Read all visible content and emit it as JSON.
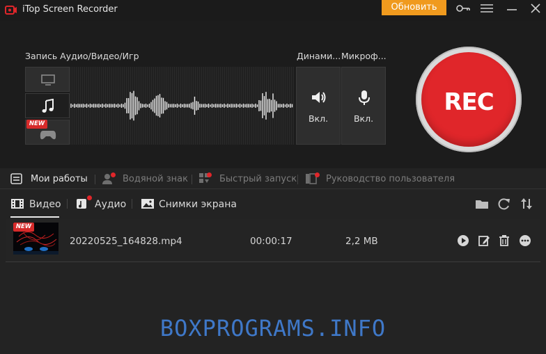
{
  "titlebar": {
    "app_title": "iTop Screen Recorder",
    "update_button": "Обновить",
    "icons": [
      "recorder-logo-icon",
      "key-icon",
      "menu-icon",
      "minimize-icon",
      "close-icon"
    ]
  },
  "record": {
    "section_label": "Запись Аудио/Видео/Игр",
    "speaker_label": "Динами...",
    "mic_label": "Микроф...",
    "speaker_state": "Вкл.",
    "mic_state": "Вкл.",
    "source_new_badge": "NEW",
    "rec_button": "REC"
  },
  "nav": {
    "items": [
      {
        "label": "Мои работы",
        "icon": "list-icon",
        "active": true
      },
      {
        "label": "Водяной знак",
        "icon": "watermark-icon",
        "active": false
      },
      {
        "label": "Быстрый запуск",
        "icon": "quick-launch-icon",
        "active": false
      },
      {
        "label": "Руководство пользователя",
        "icon": "guide-icon",
        "active": false
      }
    ]
  },
  "tabs": {
    "items": [
      {
        "label": "Видео",
        "icon": "film-icon"
      },
      {
        "label": "Аудио",
        "icon": "music-icon"
      },
      {
        "label": "Снимки экрана",
        "icon": "image-icon"
      }
    ],
    "active": "Видео",
    "tool_icons": [
      "folder-icon",
      "refresh-icon",
      "sort-icon"
    ]
  },
  "files": [
    {
      "badge": "NEW",
      "name": "20220525_164828.mp4",
      "duration": "00:00:17",
      "size": "2,2 MB",
      "actions": [
        "play-icon",
        "edit-icon",
        "delete-icon",
        "more-icon"
      ]
    }
  ],
  "watermark": "BOXPROGRAMS.INFO",
  "colors": {
    "accent_orange": "#f09a1e",
    "rec_red": "#e0262a",
    "badge_red": "#d62a2a",
    "background": "#232323",
    "watermark_blue": "#3f78c8"
  }
}
